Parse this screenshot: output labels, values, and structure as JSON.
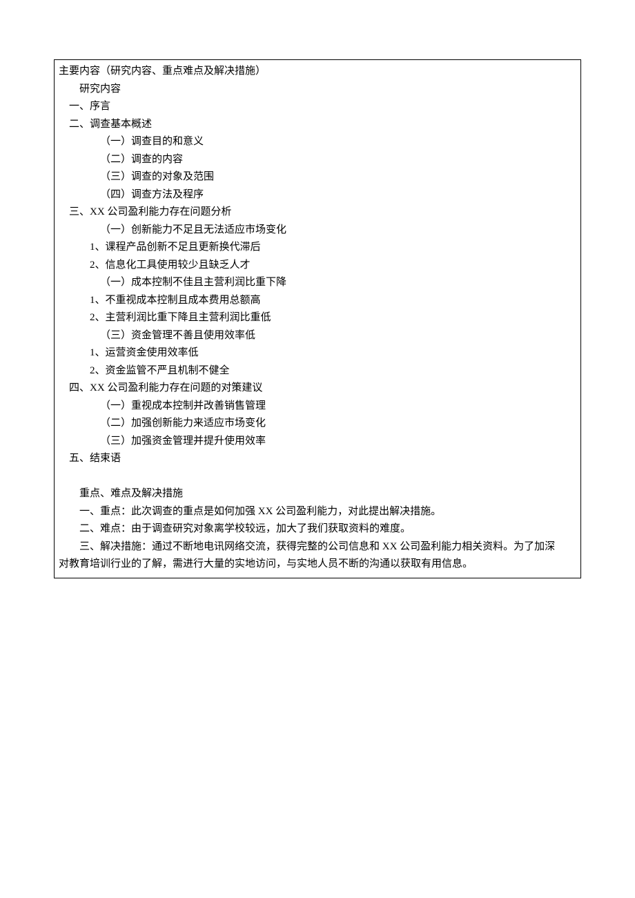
{
  "title": "主要内容（研究内容、重点难点及解决措施）",
  "h_research": "研究内容",
  "s1": "一、序言",
  "s2": "二、调查基本概述",
  "s2_1": "（一）调查目的和意义",
  "s2_2": "（二）调查的内容",
  "s2_3": "（三）调查的对象及范围",
  "s2_4": "（四）调查方法及程序",
  "s3": "三、XX 公司盈利能力存在问题分析",
  "s3_a": "（一）创新能力不足且无法适应市场变化",
  "s3_a1": "1、课程产品创新不足且更新换代滞后",
  "s3_a2": "2、信息化工具使用较少且缺乏人才",
  "s3_b": "（一）成本控制不佳且主营利润比重下降",
  "s3_b1": "1、不重视成本控制且成本费用总额高",
  "s3_b2": "2、主营利润比重下降且主营利润比重低",
  "s3_c": "（三）资金管理不善且使用效率低",
  "s3_c1": "1、运营资金使用效率低",
  "s3_c2": "2、资金监管不严且机制不健全",
  "s4": "四、XX 公司盈利能力存在问题的对策建议",
  "s4_1": "（一）重视成本控制并改善销售管理",
  "s4_2": "（二）加强创新能力来适应市场变化",
  "s4_3": "（三）加强资金管理并提升使用效率",
  "s5": "五、结束语",
  "h_diff": "重点、难点及解决措施",
  "d1": "一、重点：此次调查的重点是如何加强 XX 公司盈利能力，对此提出解决措施。",
  "d2": "二、难点：由于调查研究对象离学校较远，加大了我们获取资料的难度。",
  "d3a": "三、解决措施：通过不断地电讯网络交流，获得完整的公司信息和 XX 公司盈利能力相关资料。为了加深",
  "d3b": "对教育培训行业的了解，需进行大量的实地访问，与实地人员不断的沟通以获取有用信息。"
}
